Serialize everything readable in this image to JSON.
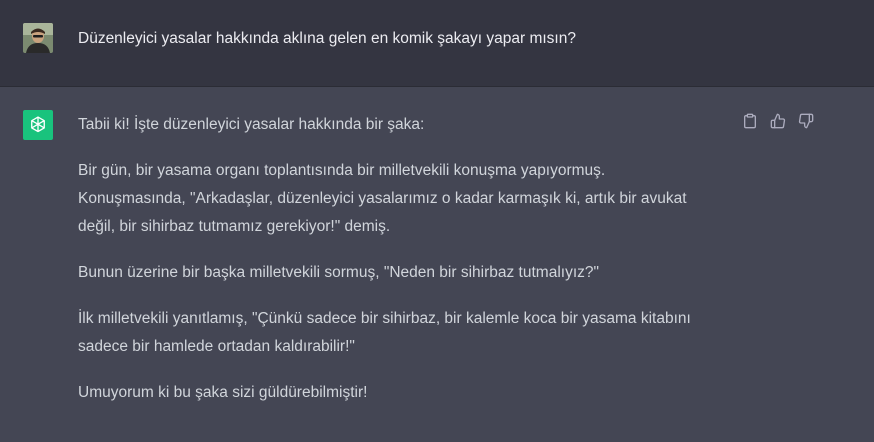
{
  "user_message": {
    "avatar_icon": "user-photo-avatar",
    "text": "Düzenleyici yasalar hakkında aklına gelen en komik şakayı yapar mısın?"
  },
  "assistant_message": {
    "avatar_icon": "openai-logo-icon",
    "avatar_color": "#19c37d",
    "paragraphs": [
      "Tabii ki! İşte düzenleyici yasalar hakkında bir şaka:",
      "Bir gün, bir yasama organı toplantısında bir milletvekili konuşma yapıyormuş.",
      "Konuşmasında, \"Arkadaşlar, düzenleyici yasalarımız o kadar karmaşık ki, artık bir avukat",
      "değil, bir sihirbaz tutmamız gerekiyor!\" demiş.",
      "Bunun üzerine bir başka milletvekili sormuş, \"Neden bir sihirbaz tutmalıyız?\"",
      "İlk milletvekili yanıtlamış, \"Çünkü sadece bir sihirbaz, bir kalemle koca bir yasama kitabını",
      "sadece bir hamlede ortadan kaldırabilir!\"",
      "Umuyorum ki bu şaka sizi güldürebilmiştir!"
    ]
  },
  "actions": {
    "copy_icon": "clipboard-icon",
    "like_icon": "thumbs-up-icon",
    "dislike_icon": "thumbs-down-icon"
  },
  "colors": {
    "user_bg": "#343541",
    "assistant_bg": "#444654",
    "text": "#d1d5db"
  }
}
